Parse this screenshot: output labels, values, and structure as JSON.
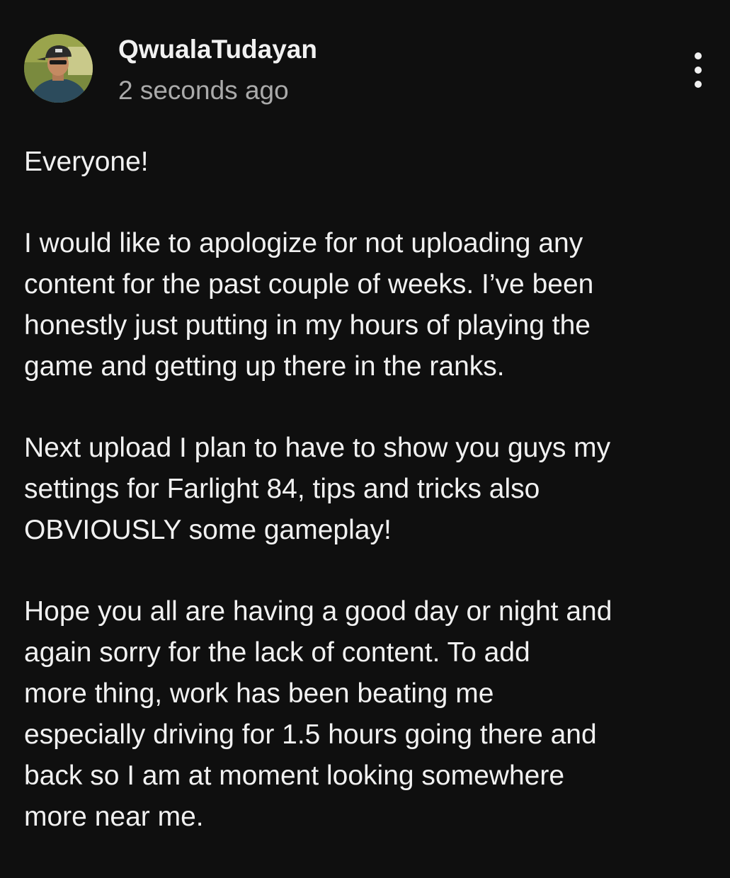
{
  "post": {
    "author": "QwualaTudayan",
    "timestamp": "2 seconds ago",
    "avatar_icon": "avatar-photo",
    "more_icon": "more-vert-icon",
    "paragraphs": [
      "Everyone!",
      "I would like to apologize for not uploading any\ncontent for the past couple of weeks.  I’ve been\nhonestly just putting in my hours of playing the\ngame and getting up there in the ranks.",
      "Next upload I plan to have to show you guys my\nsettings for Farlight 84, tips and tricks also\nOBVIOUSLY some gameplay!",
      "Hope you all are having a good day or night and\nagain sorry for the lack of content.  To add\nmore thing, work has been beating me\nespecially driving for 1.5 hours going there and\nback so I am at moment looking somewhere\nmore near me."
    ]
  },
  "colors": {
    "background": "#0f0f0f",
    "text_primary": "#f1f1f1",
    "text_secondary": "#aaaaaa"
  }
}
